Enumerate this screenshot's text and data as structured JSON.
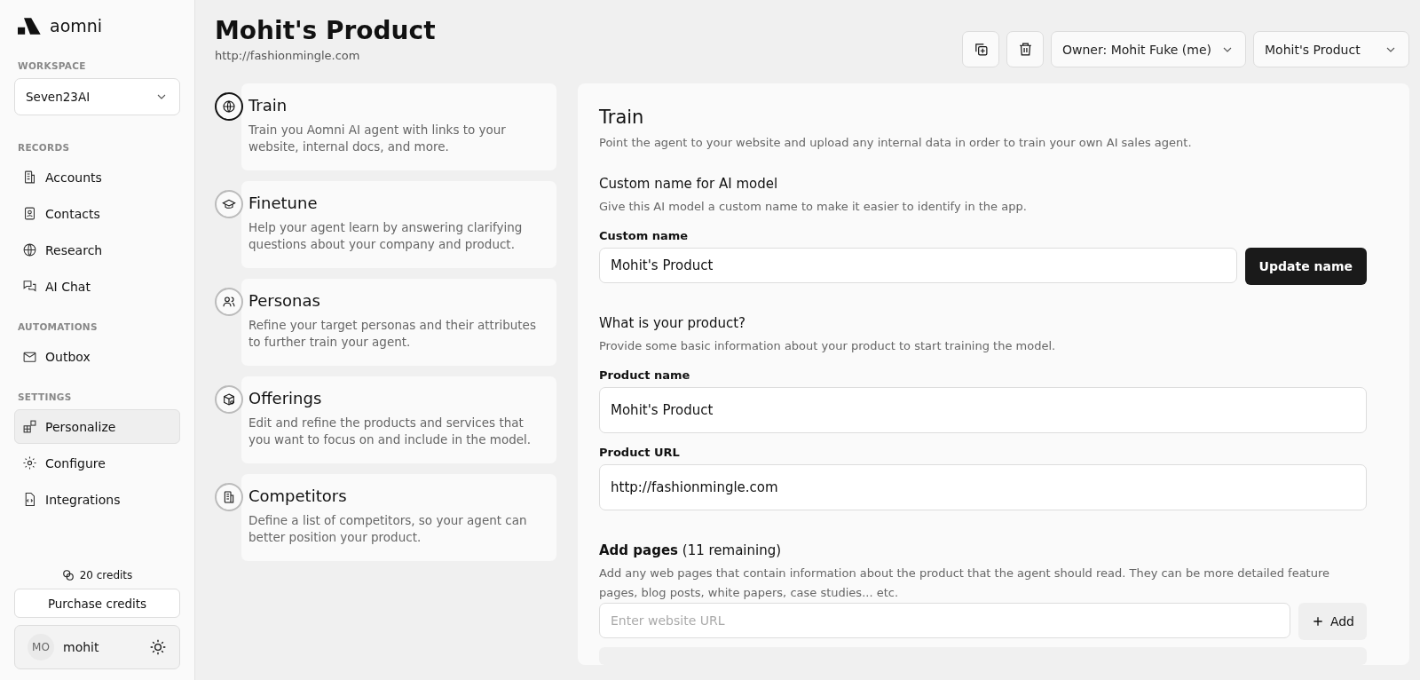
{
  "sidebar": {
    "logo": "aomni",
    "workspace": {
      "label": "WORKSPACE",
      "value": "Seven23AI"
    },
    "sections": [
      {
        "label": "RECORDS",
        "items": [
          {
            "label": "Accounts",
            "selected": false
          },
          {
            "label": "Contacts",
            "selected": false
          },
          {
            "label": "Research",
            "selected": false
          },
          {
            "label": "AI Chat",
            "selected": false
          }
        ]
      },
      {
        "label": "AUTOMATIONS",
        "items": [
          {
            "label": "Outbox",
            "selected": false
          }
        ]
      },
      {
        "label": "SETTINGS",
        "items": [
          {
            "label": "Personalize",
            "selected": true
          },
          {
            "label": "Configure",
            "selected": false
          },
          {
            "label": "Integrations",
            "selected": false
          }
        ]
      }
    ],
    "credits": "20 credits",
    "purchase_button": "Purchase credits",
    "user": {
      "initials": "MO",
      "name": "mohit"
    }
  },
  "header": {
    "title": "Mohit's Product",
    "url": "http://fashionmingle.com",
    "owner_dropdown": "Owner: Mohit Fuke (me)",
    "product_dropdown": "Mohit's Product"
  },
  "steps": [
    {
      "title": "Train",
      "description": "Train you Aomni AI agent with links to your website, internal docs, and more.",
      "selected": true
    },
    {
      "title": "Finetune",
      "description": "Help your agent learn by answering clarifying questions about your company and product.",
      "selected": false
    },
    {
      "title": "Personas",
      "description": "Refine your target personas and their attributes to further train your agent.",
      "selected": false
    },
    {
      "title": "Offerings",
      "description": "Edit and refine the products and services that you want to focus on and include in the model.",
      "selected": false
    },
    {
      "title": "Competitors",
      "description": "Define a list of competitors, so your agent can better position your product.",
      "selected": false
    }
  ],
  "panel": {
    "title": "Train",
    "subtitle": "Point the agent to your website and upload any internal data in order to train your own AI sales agent.",
    "custom_name": {
      "heading": "Custom name for AI model",
      "description": "Give this AI model a custom name to make it easier to identify in the app.",
      "label": "Custom name",
      "value": "Mohit's Product",
      "button": "Update name"
    },
    "product": {
      "heading": "What is your product?",
      "description": "Provide some basic information about your product to start training the model.",
      "name_label": "Product name",
      "name_value": "Mohit's Product",
      "url_label": "Product URL",
      "url_value": "http://fashionmingle.com"
    },
    "add_pages": {
      "heading": "**Add pages** (11 remaining)",
      "description": "Add any web pages that contain information about the product that the agent should read. They can be more detailed feature pages, blog posts, white papers, case studies... etc.",
      "placeholder": "Enter website URL",
      "button": "Add"
    }
  }
}
